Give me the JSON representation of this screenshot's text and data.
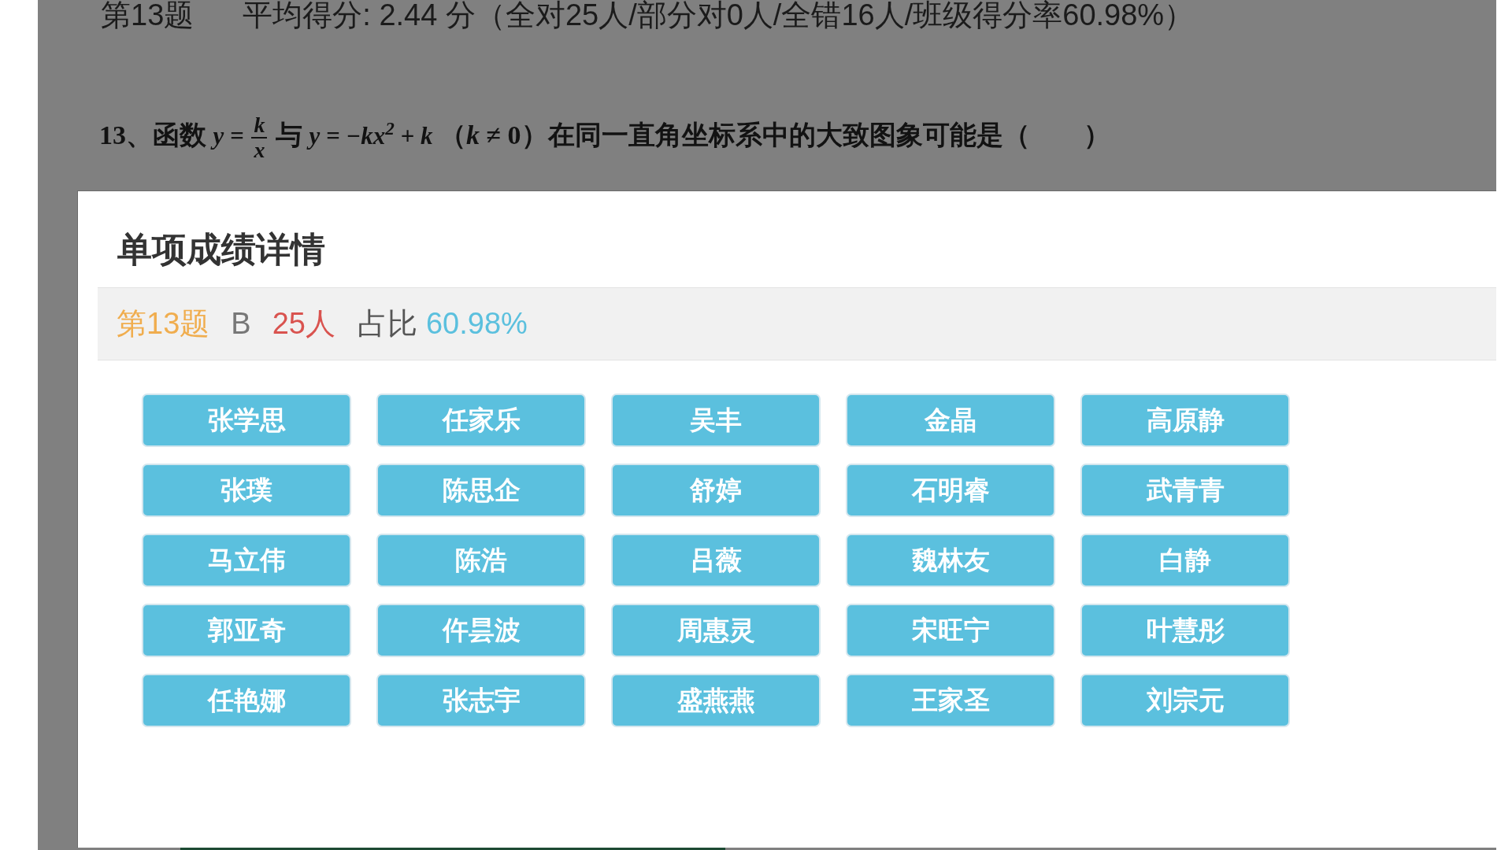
{
  "header": {
    "question": "第13题",
    "stats": "平均得分: 2.44 分（全对25人/部分对0人/全错16人/班级得分率60.98%）"
  },
  "question": {
    "segments": [
      {
        "kind": "text",
        "text": "13、函数 "
      },
      {
        "kind": "math",
        "text": "y = "
      },
      {
        "kind": "fraction",
        "numerator": "k",
        "denominator": "x"
      },
      {
        "kind": "text",
        "text": " 与 "
      },
      {
        "kind": "math",
        "text": "y = −kx$^{2}$ + k"
      },
      {
        "kind": "text",
        "text": " （*k* ≠ 0）在同一直角坐标系中的大致图象可能是（　　）"
      }
    ]
  },
  "dialog": {
    "title": "单项成绩详情",
    "summary": {
      "question": "第13题",
      "answer": "B",
      "count": "25人",
      "ratio_label": "占比",
      "ratio": "60.98%"
    },
    "students": [
      "张学思",
      "任家乐",
      "吴丰",
      "金晶",
      "高原静",
      "张璞",
      "陈思企",
      "舒婷",
      "石明睿",
      "武青青",
      "马立伟",
      "陈浩",
      "吕薇",
      "魏林友",
      "白静",
      "郭亚奇",
      "仵昙波",
      "周惠灵",
      "宋旺宁",
      "叶慧彤",
      "任艳娜",
      "张志宇",
      "盛燕燕",
      "王家圣",
      "刘宗元"
    ]
  }
}
